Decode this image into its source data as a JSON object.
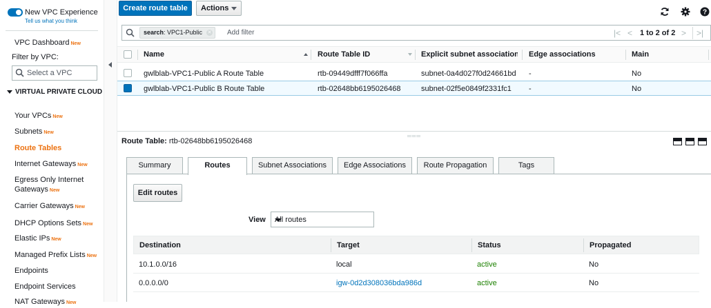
{
  "sidebar": {
    "new_vpc_experience": "New VPC Experience",
    "tell_us": "Tell us what you think",
    "vpc_dashboard": "VPC Dashboard",
    "new_badge": "New",
    "filter_by_vpc": "Filter by VPC:",
    "select_vpc_placeholder": "Select a VPC",
    "section_title": "VIRTUAL PRIVATE CLOUD",
    "items": [
      {
        "label": "Your VPCs",
        "badge": "New",
        "active": false
      },
      {
        "label": "Subnets",
        "badge": "New",
        "active": false
      },
      {
        "label": "Route Tables",
        "badge": "",
        "active": true
      },
      {
        "label": "Internet Gateways",
        "badge": "New",
        "active": false
      },
      {
        "label": "Egress Only Internet",
        "label2": "Gateways",
        "badge": "New",
        "active": false
      },
      {
        "label": "Carrier Gateways",
        "badge": "New",
        "active": false
      },
      {
        "label": "DHCP Options Sets",
        "badge": "New",
        "active": false
      },
      {
        "label": "Elastic IPs",
        "badge": "New",
        "active": false
      },
      {
        "label": "Managed Prefix Lists",
        "badge": "New",
        "active": false
      },
      {
        "label": "Endpoints",
        "badge": "",
        "active": false
      },
      {
        "label": "Endpoint Services",
        "badge": "",
        "active": false
      },
      {
        "label": "NAT Gateways",
        "badge": "New",
        "active": false
      }
    ]
  },
  "toolbar": {
    "create_label": "Create route table",
    "actions_label": "Actions",
    "refresh_icon": "refresh-icon",
    "settings_icon": "gear-icon",
    "help_icon": "help-icon"
  },
  "filter": {
    "chip_key": "search",
    "chip_value": ": VPC1-Public",
    "add_filter_placeholder": "Add filter",
    "pagination": "1 to 2 of 2"
  },
  "grid": {
    "columns": [
      "Name",
      "Route Table ID",
      "Explicit subnet associations",
      "Edge associations",
      "Main"
    ],
    "rows": [
      {
        "name": "gwlblab-VPC1-Public A Route Table",
        "id": "rtb-09449dfff7f066ffa",
        "subnet": "subnet-0a4d027f0d24661bd",
        "edge": "-",
        "main": "No",
        "selected": false
      },
      {
        "name": "gwlblab-VPC1-Public B Route Table",
        "id": "rtb-02648bb6195026468",
        "subnet": "subnet-02f5e0849f2331fc1",
        "edge": "-",
        "main": "No",
        "selected": true
      }
    ]
  },
  "details": {
    "label": "Route Table:",
    "value": "rtb-02648bb6195026468",
    "tabs": [
      "Summary",
      "Routes",
      "Subnet Associations",
      "Edge Associations",
      "Route Propagation",
      "Tags"
    ],
    "active_tab": "Routes",
    "edit_routes": "Edit routes",
    "view_label": "View",
    "view_value": "All routes",
    "route_columns": [
      "Destination",
      "Target",
      "Status",
      "Propagated"
    ],
    "routes": [
      {
        "destination": "10.1.0.0/16",
        "target": "local",
        "status": "active",
        "propagated": "No"
      },
      {
        "destination": "0.0.0.0/0",
        "target": "igw-0d2d308036bda986d",
        "status": "active",
        "propagated": "No"
      }
    ]
  },
  "colors": {
    "accent": "#0073bb",
    "active_nav": "#ec7211",
    "status_active": "#1d8102"
  }
}
